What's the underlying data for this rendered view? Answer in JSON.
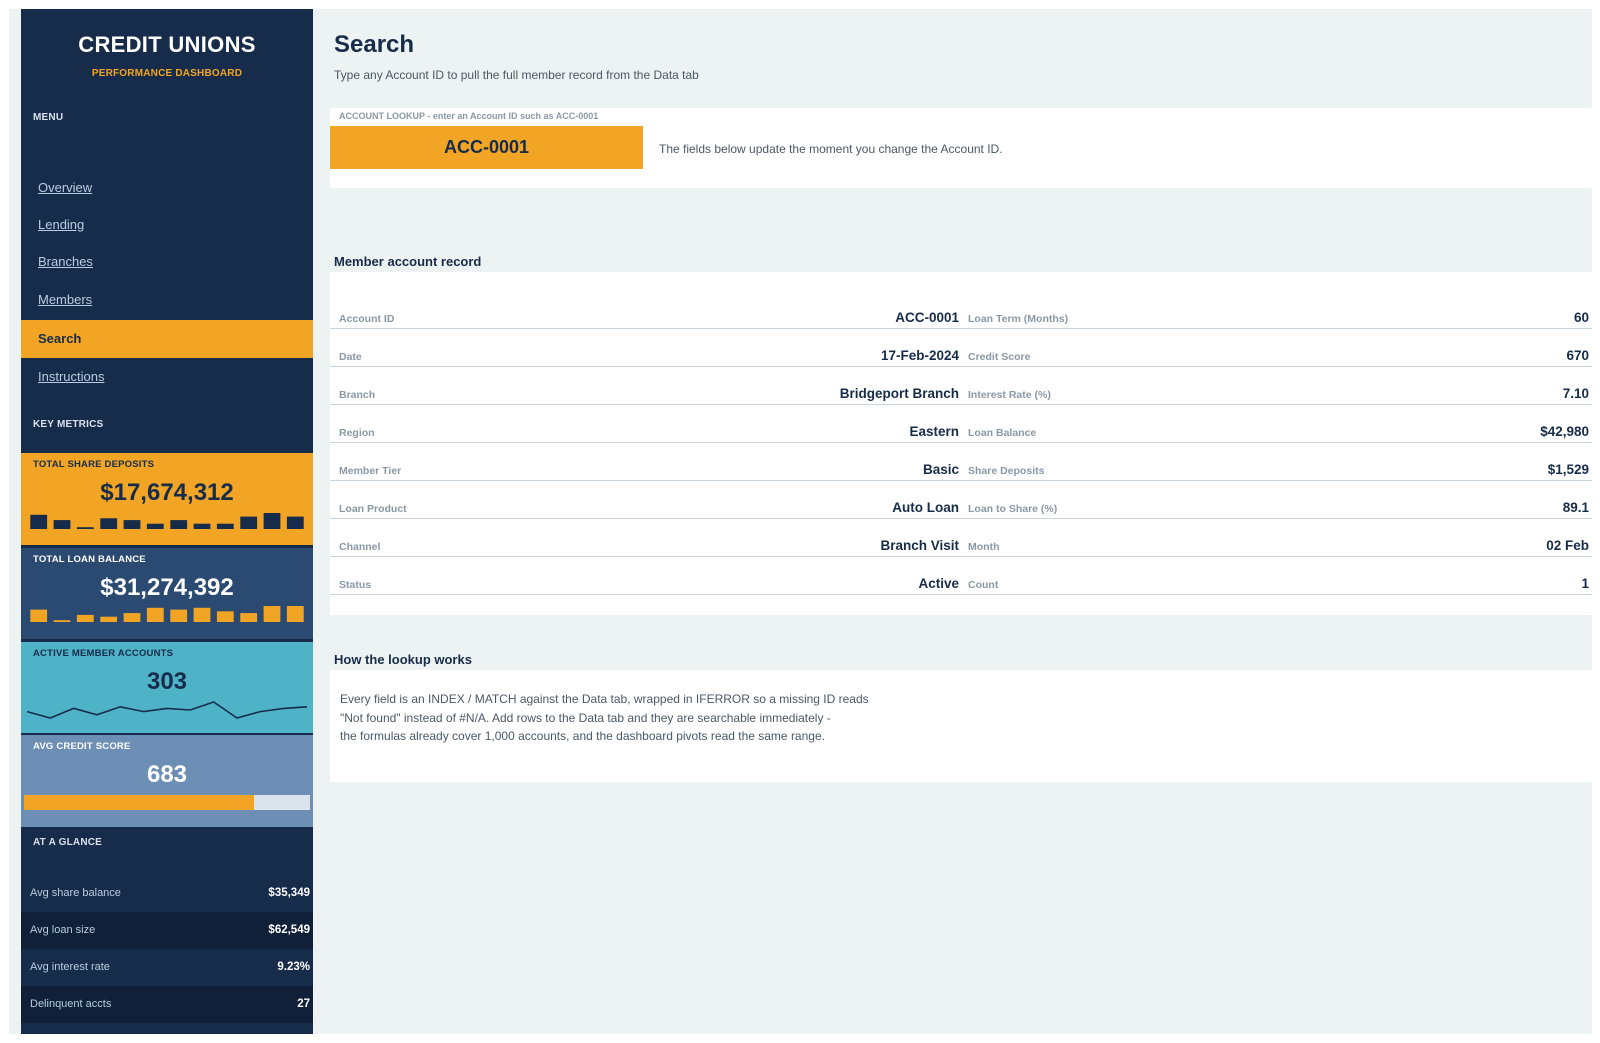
{
  "sidebar": {
    "brand_title": "CREDIT UNIONS",
    "brand_subtitle": "PERFORMANCE DASHBOARD",
    "menu_label": "MENU",
    "nav": [
      {
        "label": "Overview",
        "active": false
      },
      {
        "label": "Lending",
        "active": false
      },
      {
        "label": "Branches",
        "active": false
      },
      {
        "label": "Members",
        "active": false
      },
      {
        "label": "Search",
        "active": true
      },
      {
        "label": "Instructions",
        "active": false
      }
    ],
    "metrics_label": "KEY METRICS",
    "kpis": {
      "deposits": {
        "label": "TOTAL SHARE DEPOSITS",
        "value": "$17,674,312",
        "bars": [
          8,
          5,
          1,
          6,
          5,
          3,
          5,
          3,
          3,
          7,
          9,
          7
        ]
      },
      "loans": {
        "label": "TOTAL LOAN BALANCE",
        "value": "$31,274,392",
        "bars": [
          7,
          1,
          4,
          3,
          5,
          8,
          7,
          8,
          6,
          5,
          9,
          9
        ]
      },
      "members": {
        "label": "ACTIVE MEMBER ACCOUNTS",
        "value": "303",
        "trend": [
          5,
          3,
          6,
          4,
          6.5,
          5,
          6,
          5.5,
          8,
          3,
          5,
          6,
          6.5
        ]
      },
      "credit": {
        "label": "AVG CREDIT SCORE",
        "value": "683",
        "progress": 0.805
      }
    },
    "glance_label": "AT A GLANCE",
    "glance": [
      {
        "label": "Avg share balance",
        "value": "$35,349"
      },
      {
        "label": "Avg loan size",
        "value": "$62,549"
      },
      {
        "label": "Avg interest rate",
        "value": "9.23%"
      },
      {
        "label": "Delinquent accts",
        "value": "27"
      }
    ]
  },
  "main": {
    "title": "Search",
    "subtitle": "Type any Account ID to pull the full member record from the Data tab",
    "lookup": {
      "label": "ACCOUNT LOOKUP  -  enter an Account ID such as ACC-0001",
      "value": "ACC-0001",
      "note": "The fields below update the moment you change the Account ID."
    },
    "record_heading": "Member account record",
    "record_left": [
      {
        "label": "Account ID",
        "value": "ACC-0001"
      },
      {
        "label": "Date",
        "value": "17-Feb-2024"
      },
      {
        "label": "Branch",
        "value": "Bridgeport Branch"
      },
      {
        "label": "Region",
        "value": "Eastern"
      },
      {
        "label": "Member Tier",
        "value": "Basic"
      },
      {
        "label": "Loan Product",
        "value": "Auto Loan"
      },
      {
        "label": "Channel",
        "value": "Branch Visit"
      },
      {
        "label": "Status",
        "value": "Active"
      }
    ],
    "record_right": [
      {
        "label": "Loan Term (Months)",
        "value": "60"
      },
      {
        "label": "Credit Score",
        "value": "670"
      },
      {
        "label": "Interest Rate (%)",
        "value": "7.10"
      },
      {
        "label": "Loan Balance",
        "value": "$42,980"
      },
      {
        "label": "Share Deposits",
        "value": "$1,529"
      },
      {
        "label": "Loan to Share (%)",
        "value": "89.1"
      },
      {
        "label": "Month",
        "value": "02 Feb"
      },
      {
        "label": "Count",
        "value": "1"
      }
    ],
    "howto_heading": "How the lookup works",
    "howto_lines": [
      "Every field is an INDEX / MATCH against the Data tab, wrapped in IFERROR so a missing ID reads",
      "\"Not found\" instead of #N/A. Add rows to the Data tab and they are searchable immediately -",
      "the formulas already cover 1,000 accounts, and the dashboard pivots read the same range."
    ]
  },
  "colors": {
    "navy": "#172c4a",
    "orange": "#f2a525",
    "loan_tile": "#2a4a72",
    "members_tile": "#4fb3c8",
    "credit_tile": "#6d8fb6",
    "background": "#edf2f2"
  }
}
